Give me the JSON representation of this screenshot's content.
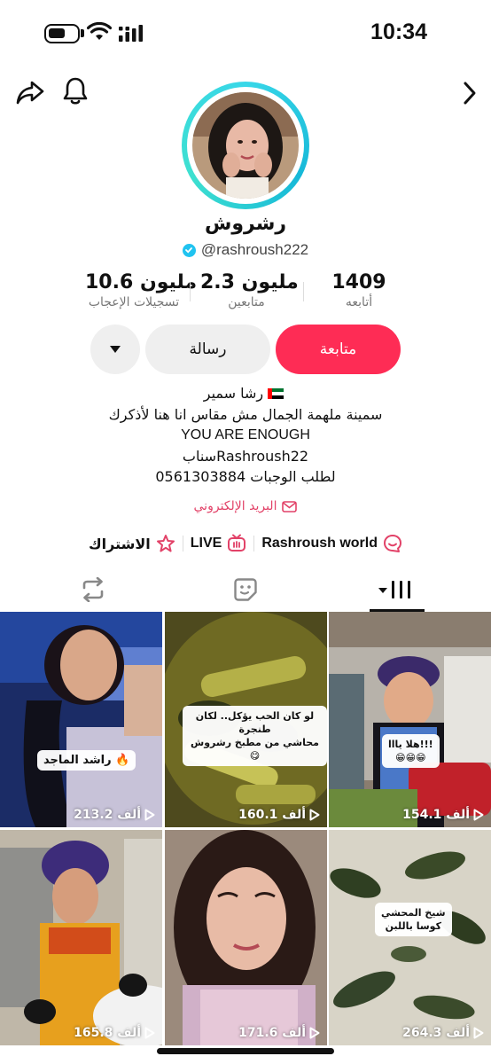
{
  "status_bar": {
    "time": "10:34"
  },
  "profile": {
    "display_name": "رشروش",
    "username": "@rashroush222"
  },
  "stats": {
    "following": {
      "value": "1409",
      "label": "أتابعه"
    },
    "followers": {
      "value": "2.3 مليون",
      "label": "متابعين"
    },
    "likes": {
      "value": "10.6 مليون",
      "label": "تسجيلات الإعجاب"
    }
  },
  "actions": {
    "follow_label": "متابعة",
    "message_label": "رسالة"
  },
  "bio": {
    "line1": "رشا سمير",
    "line2": "سمينة ملهمة الجمال مش مقاس انا هنا لأذكرك",
    "line3": "YOU ARE ENOUGH",
    "line4": "سنابRashroush22",
    "line5": "0561303884 لطلب الوجبات"
  },
  "email_label": "البريد الإلكتروني",
  "links": {
    "community": "Rashroush world",
    "live": "LIVE",
    "subscribe": "الاشتراك"
  },
  "videos": [
    {
      "views": "154.1 ألف",
      "caption": "هلا يااا!!!\n😁😁😁"
    },
    {
      "views": "160.1 ألف",
      "caption": "لو كان الحب يؤكل.. لكان طنجرة\nمحاشي من مطبخ رشروش 😋"
    },
    {
      "views": "213.2 ألف",
      "caption": "راشد الماجد 🔥"
    },
    {
      "views": "264.3 ألف",
      "caption": "شيخ المحشي\nكوسا باللبن"
    },
    {
      "views": "171.6 ألف",
      "caption": ""
    },
    {
      "views": "165.8 ألف",
      "caption": ""
    }
  ]
}
